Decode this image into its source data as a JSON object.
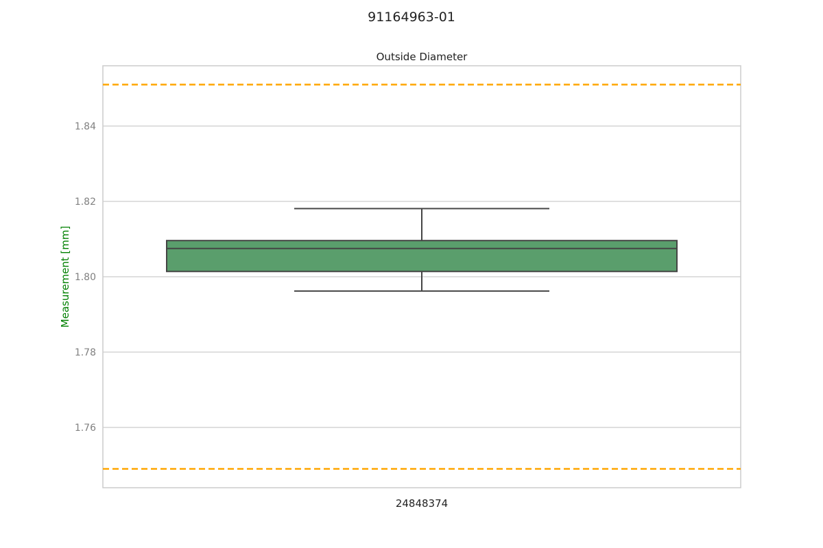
{
  "figure": {
    "suptitle": "91164963-01"
  },
  "chart_data": {
    "type": "box",
    "title": "Outside Diameter",
    "xlabel": "",
    "ylabel": "Measurement [mm]",
    "ylim": [
      1.744,
      1.856
    ],
    "y_ticks": [
      "1.76",
      "1.78",
      "1.80",
      "1.82",
      "1.84"
    ],
    "grid": true,
    "categories": [
      "24848374"
    ],
    "boxes": [
      {
        "category": "24848374",
        "whisker_low": 1.7962,
        "q1": 1.8014,
        "median": 1.8075,
        "q3": 1.8096,
        "whisker_high": 1.8181
      }
    ],
    "reference_lines": [
      {
        "value": 1.851,
        "color": "#FFA500"
      },
      {
        "value": 1.749,
        "color": "#FFA500"
      }
    ],
    "colors": {
      "box_fill": "#5A9E6C",
      "box_edge": "#444444",
      "ylabel_color": "#008000",
      "tick_color": "#808080",
      "grid_color": "#CCCCCC",
      "spine_color": "#CCCCCC"
    }
  }
}
